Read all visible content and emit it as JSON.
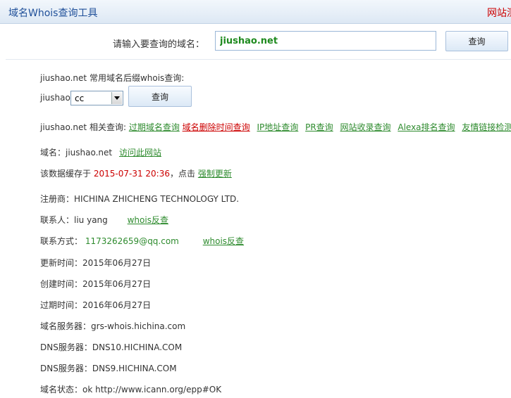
{
  "header": {
    "title": "域名Whois查询工具",
    "right_text": "网站测"
  },
  "search": {
    "label": "请输入要查询的域名：",
    "value": "jiushao.net",
    "button_label": "查询"
  },
  "suffix_query": {
    "heading": "jiushao.net 常用域名后缀whois查询:",
    "prefix": "jiushao.",
    "selected_suffix": "cc",
    "button_label": "查询"
  },
  "related": {
    "label": "jiushao.net 相关查询:",
    "links": [
      {
        "label": "过期域名查询",
        "color": "#2e8b2e"
      },
      {
        "label": "域名删除时间查询",
        "color": "#cc0000"
      },
      {
        "label": "IP地址查询",
        "color": "#2e8b2e"
      },
      {
        "label": "PR查询",
        "color": "#2e8b2e"
      },
      {
        "label": "网站收录查询",
        "color": "#2e8b2e"
      },
      {
        "label": "Alexa排名查询",
        "color": "#2e8b2e"
      },
      {
        "label": "友情链接检测",
        "color": "#2e8b2e"
      }
    ]
  },
  "domain_line": {
    "label": "域名：jiushao.net",
    "visit_link": "访问此网站"
  },
  "cache_line": {
    "prefix": "该数据缓存于",
    "timestamp": "2015-07-31 20:36",
    "middle": "，点击",
    "refresh_link": "强制更新"
  },
  "whois": {
    "registrar_label": "注册商：",
    "registrar_value": "HICHINA ZHICHENG TECHNOLOGY LTD.",
    "contact_label": "联系人：",
    "contact_value": "liu yang",
    "contact_reverse": "whois反查",
    "contact_method_label": "联系方式：",
    "contact_method_value": "1173262659@qq.com",
    "contact_method_reverse": "whois反查",
    "updated_label": "更新时间：",
    "updated_value": "2015年06月27日",
    "created_label": "创建时间：",
    "created_value": "2015年06月27日",
    "expires_label": "过期时间：",
    "expires_value": "2016年06月27日",
    "whois_server_label": "域名服务器：",
    "whois_server_value": "grs-whois.hichina.com",
    "dns1_label": "DNS服务器：",
    "dns1_value": "DNS10.HICHINA.COM",
    "dns2_label": "DNS服务器：",
    "dns2_value": "DNS9.HICHINA.COM",
    "status_label": "域名状态：",
    "status_value": "ok http://www.icann.org/epp#OK"
  }
}
